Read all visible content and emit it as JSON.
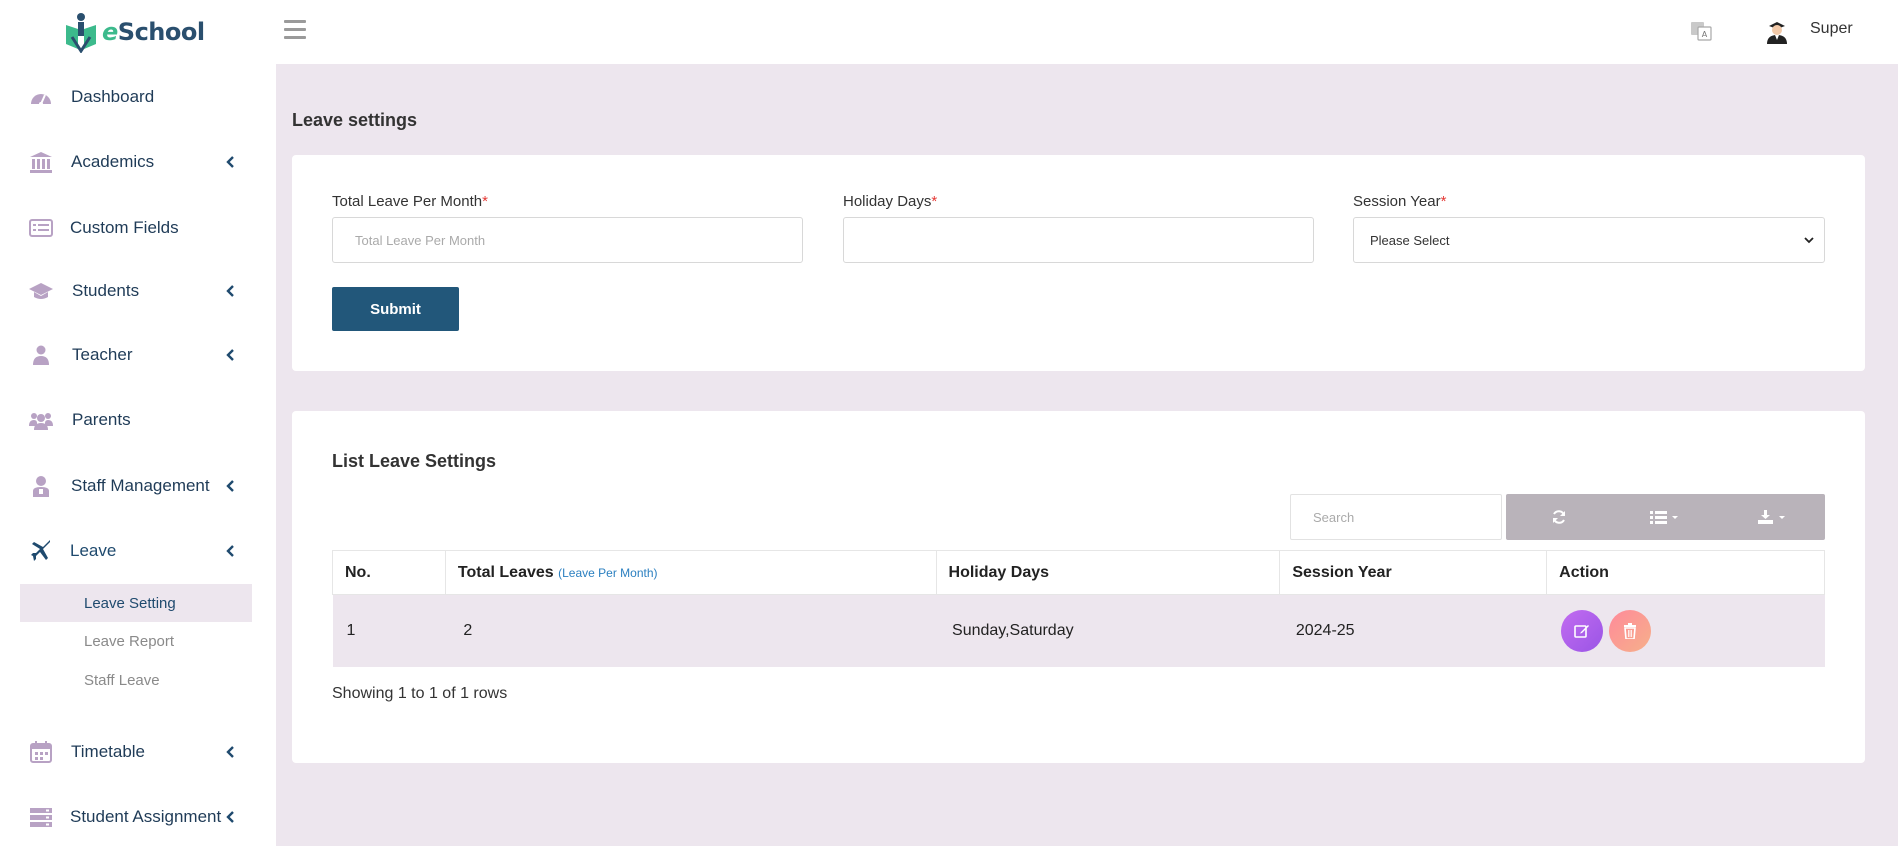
{
  "app": {
    "logo_prefix": "e",
    "logo_rest": "School"
  },
  "sidebar": {
    "items": [
      {
        "label": "Dashboard",
        "icon": "dashboard-icon",
        "has_submenu": false
      },
      {
        "label": "Academics",
        "icon": "university-icon",
        "has_submenu": true
      },
      {
        "label": "Custom Fields",
        "icon": "list-form-icon",
        "has_submenu": false
      },
      {
        "label": "Students",
        "icon": "graduation-cap-icon",
        "has_submenu": true
      },
      {
        "label": "Teacher",
        "icon": "user-icon",
        "has_submenu": true
      },
      {
        "label": "Parents",
        "icon": "users-icon",
        "has_submenu": false
      },
      {
        "label": "Staff Management",
        "icon": "staff-icon",
        "has_submenu": true
      },
      {
        "label": "Leave",
        "icon": "plane-icon",
        "has_submenu": true,
        "active": true
      },
      {
        "label": "Timetable",
        "icon": "calendar-icon",
        "has_submenu": true
      },
      {
        "label": "Student Assignment",
        "icon": "server-icon",
        "has_submenu": true
      }
    ],
    "leave_submenu": [
      "Leave Setting",
      "Leave Report",
      "Staff Leave"
    ]
  },
  "topbar": {
    "user_name": "Super"
  },
  "page": {
    "title": "Leave settings"
  },
  "form": {
    "total_leave_label": "Total Leave Per Month",
    "total_leave_placeholder": "Total Leave Per Month",
    "holiday_days_label": "Holiday Days",
    "holiday_days_value": "",
    "session_year_label": "Session Year",
    "session_year_value": "Please Select",
    "required_mark": "*",
    "submit_label": "Submit"
  },
  "list": {
    "title": "List Leave Settings",
    "search_placeholder": "Search",
    "columns": {
      "no": "No.",
      "total_leaves": "Total Leaves",
      "total_leaves_sub": "(Leave Per Month)",
      "holiday_days": "Holiday Days",
      "session_year": "Session Year",
      "action": "Action"
    },
    "rows": [
      {
        "no": "1",
        "total_leaves": "2",
        "holiday_days": "Sunday,Saturday",
        "session_year": "2024-25"
      }
    ],
    "showing": "Showing 1 to 1 of 1 rows"
  },
  "colors": {
    "primary": "#22577a",
    "background": "#ede6ee",
    "icon_purple": "#b8a2c4",
    "edit_button": "#a65fe9",
    "delete_button": "#f7929a"
  }
}
